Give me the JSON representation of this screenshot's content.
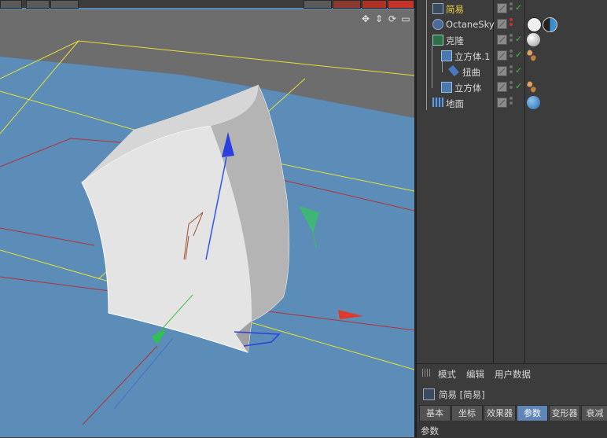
{
  "viewport": {
    "nav_icons": [
      "move-icon",
      "scale-icon",
      "rotate-icon",
      "maximize-icon"
    ],
    "nav_glyphs": [
      "✥",
      "⇕",
      "⟳",
      "▭"
    ],
    "colors": {
      "sky": "#5b8db8",
      "ground": "#6d6d6d",
      "object": "#e6e6e6",
      "grid_yellow": "#e6e032",
      "grid_red": "#b43232"
    }
  },
  "object_manager": {
    "rows": [
      {
        "name": "简易",
        "type": "deformer",
        "highlight": true
      },
      {
        "name": "OctaneSky",
        "type": "sky"
      },
      {
        "name": "克隆",
        "type": "cloner"
      },
      {
        "name": "立方体.1",
        "type": "cube"
      },
      {
        "name": "扭曲",
        "type": "bend"
      },
      {
        "name": "立方体",
        "type": "cube"
      },
      {
        "name": "地面",
        "type": "floor"
      }
    ]
  },
  "attributes": {
    "menu": [
      "模式",
      "编辑",
      "用户数据"
    ],
    "title": "简易 [简易]",
    "tabs": [
      "基本",
      "坐标",
      "效果器",
      "参数",
      "变形器",
      "衰减"
    ],
    "active_tab": "参数",
    "section": "参数"
  }
}
